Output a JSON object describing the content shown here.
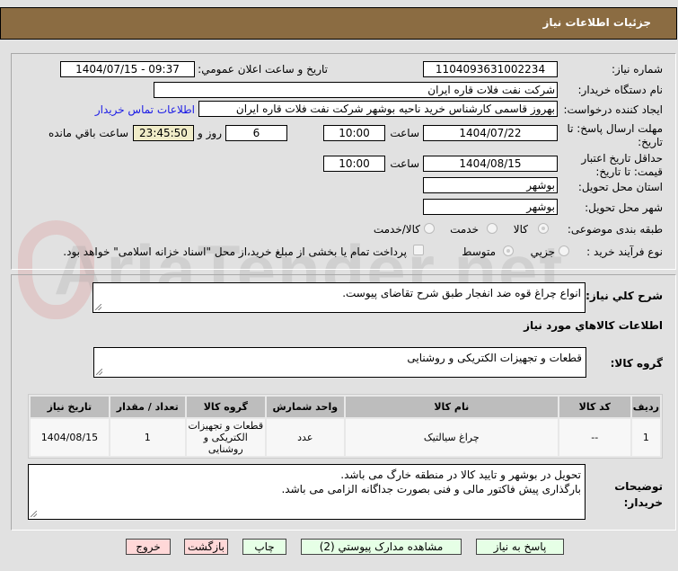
{
  "header": {
    "title": "جزئیات اطلاعات نیاز"
  },
  "watermark": "AriaTender.net",
  "form": {
    "need_number_label": "شماره نیاز:",
    "need_number": "1104093631002234",
    "announce_label": "تاریخ و ساعت اعلان عمومي:",
    "announce_value": "1404/07/15 - 09:37",
    "buyer_label": "نام دستگاه خريدار:",
    "buyer_value": "شرکت نفت فلات قاره ایران",
    "creator_label": "ايجاد کننده درخواست:",
    "creator_value": "بهروز قاسمی کارشناس خرید ناحیه بوشهر شرکت نفت فلات قاره ایران",
    "contact_link": "اطلاعات تماس خريدار",
    "deadline_label": "مهلت ارسال پاسخ: تا تاریخ:",
    "deadline_date": "1404/07/22",
    "time_label": "ساعت",
    "deadline_time": "10:00",
    "days": "6",
    "days_label": "روز و",
    "remaining": "23:45:50",
    "remaining_label": "ساعت باقي مانده",
    "validity_label": "حداقل تاریخ اعتبار قیمت: تا تاریخ:",
    "validity_date": "1404/08/15",
    "validity_time": "10:00",
    "province_label": "استان محل تحویل:",
    "province": "بوشهر",
    "city_label": "شهر محل تحویل:",
    "city": "بوشهر",
    "category_label": "طبقه بندی موضوعی:",
    "category_options": [
      "کالا",
      "خدمت",
      "کالا/خدمت"
    ],
    "category_selected": "کالا",
    "process_label": "نوع فرآیند خرید :",
    "process_options": [
      "جزيي",
      "متوسط"
    ],
    "payment_note": "پرداخت تمام یا بخشی از مبلغ خرید،از محل \"اسناد خزانه اسلامی\" خواهد بود."
  },
  "details": {
    "summary_label": "شرح کلي نياز:",
    "summary": "انواع چراغ قوه ضد انفجار طبق شرح تقاضای پیوست.",
    "goods_title": "اطلاعات کالاهاي مورد نياز",
    "group_label": "گروه کالا:",
    "group": "قطعات و تجهیزات الکتریکی و روشنایی",
    "table": {
      "headers": [
        "ردیف",
        "کد کالا",
        "نام کالا",
        "واحد شمارش",
        "گروه کالا",
        "تعداد / مقدار",
        "تاریخ نیاز"
      ],
      "rows": [
        [
          "1",
          "--",
          "چراغ سیالتیک",
          "عدد",
          "قطعات و تجهیزات الکتریکی و روشنایی",
          "1",
          "1404/08/15"
        ]
      ]
    },
    "notes_label": "توضیحات خریدار:",
    "notes_line1": "تحویل در بوشهر و تایید کالا در منطقه خارگ می باشد.",
    "notes_line2": "بارگذاری پیش فاکتور مالی و فنی بصورت جداگانه الزامی می باشد."
  },
  "buttons": {
    "reply": "پاسخ به نیاز",
    "attachments": "مشاهده مدارک پیوستي (2)",
    "print": "چاپ",
    "back": "بازگشت",
    "exit": "خروج"
  },
  "colors": {
    "header": "#8b6c42",
    "remaining_bg": "#f0ecc8",
    "link": "#1a1ae6",
    "green_button": "#e6ffe6",
    "pink_button": "#ffd8d8"
  }
}
